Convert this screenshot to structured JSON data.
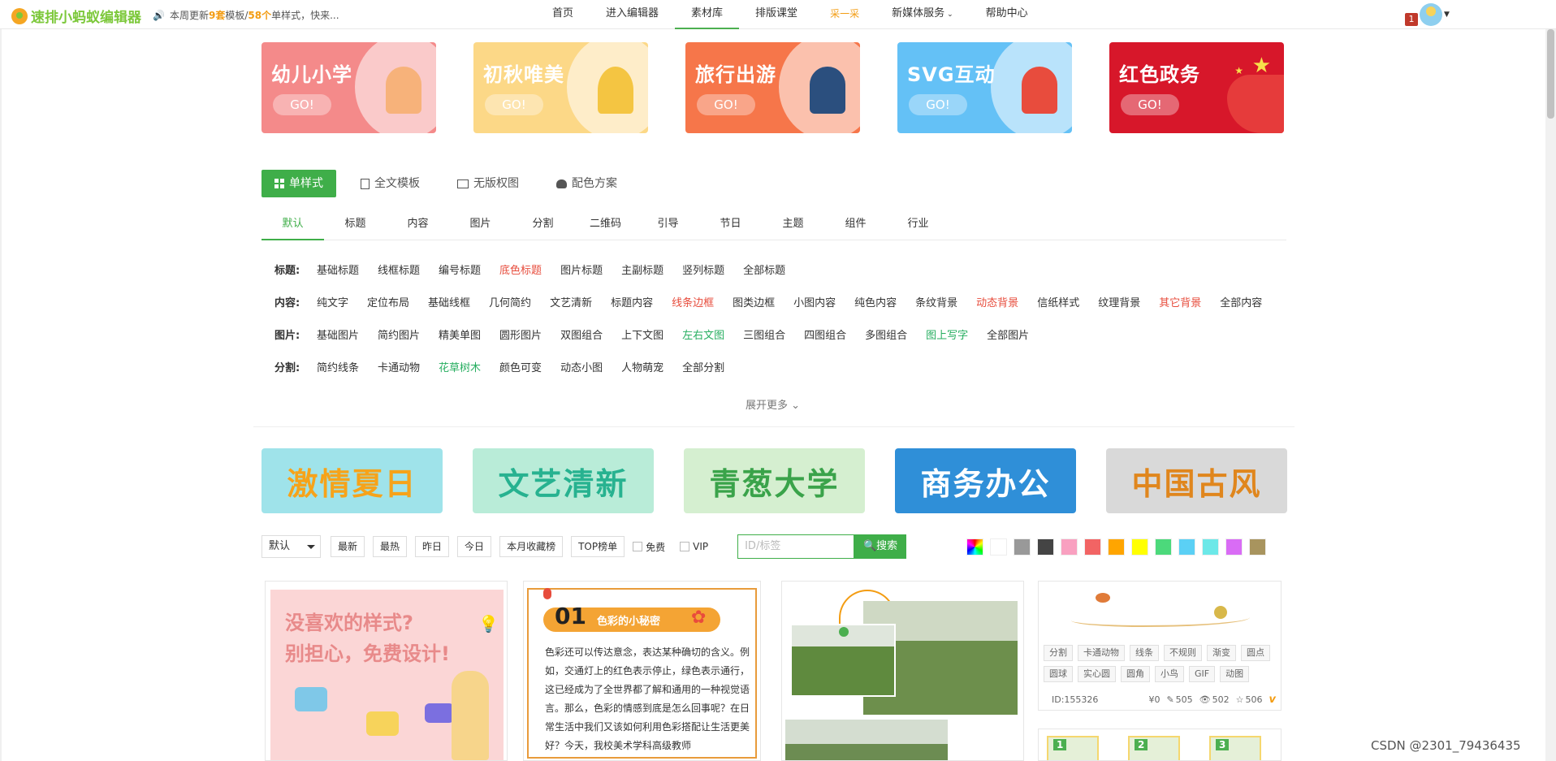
{
  "header": {
    "logo": "速排小蚂蚁编辑器",
    "notice": {
      "prefix": "本周更新",
      "count1": "9套",
      "mid": "模板/",
      "count2": "58个",
      "suffix": "单样式，快来..."
    },
    "nav": [
      {
        "label": "首页"
      },
      {
        "label": "进入编辑器"
      },
      {
        "label": "素材库"
      },
      {
        "label": "排版课堂"
      },
      {
        "label": "采一采"
      },
      {
        "label": "新媒体服务"
      },
      {
        "label": "帮助中心"
      }
    ],
    "badge": "1"
  },
  "banners": [
    {
      "title": "幼儿小学",
      "go": "GO!",
      "color": "#f48a8a"
    },
    {
      "title": "初秋唯美",
      "go": "GO!",
      "color": "#fcd887"
    },
    {
      "title": "旅行出游",
      "go": "GO!",
      "color": "#f6764a"
    },
    {
      "title": "SVG互动",
      "go": "GO!",
      "color": "#64c1f6"
    },
    {
      "title": "红色政务",
      "go": "GO!",
      "color": "#d7172a"
    }
  ],
  "type_tabs": [
    {
      "label": "单样式",
      "icon": "grid-icon"
    },
    {
      "label": "全文模板",
      "icon": "document-icon"
    },
    {
      "label": "无版权图",
      "icon": "image-icon"
    },
    {
      "label": "配色方案",
      "icon": "palette-icon"
    }
  ],
  "sub_tabs": [
    "默认",
    "标题",
    "内容",
    "图片",
    "分割",
    "二维码",
    "引导",
    "节日",
    "主题",
    "组件",
    "行业"
  ],
  "tag_rows": [
    {
      "label": "标题:",
      "tags": [
        {
          "t": "基础标题"
        },
        {
          "t": "线框标题"
        },
        {
          "t": "编号标题"
        },
        {
          "t": "底色标题",
          "c": "red"
        },
        {
          "t": "图片标题"
        },
        {
          "t": "主副标题"
        },
        {
          "t": "竖列标题"
        },
        {
          "t": "全部标题"
        }
      ]
    },
    {
      "label": "内容:",
      "tags": [
        {
          "t": "纯文字"
        },
        {
          "t": "定位布局"
        },
        {
          "t": "基础线框"
        },
        {
          "t": "几何简约"
        },
        {
          "t": "文艺清新"
        },
        {
          "t": "标题内容"
        },
        {
          "t": "线条边框",
          "c": "red"
        },
        {
          "t": "图类边框"
        },
        {
          "t": "小图内容"
        },
        {
          "t": "纯色内容"
        },
        {
          "t": "条纹背景"
        },
        {
          "t": "动态背景",
          "c": "red"
        },
        {
          "t": "信纸样式"
        },
        {
          "t": "纹理背景"
        },
        {
          "t": "其它背景",
          "c": "red"
        },
        {
          "t": "全部内容"
        }
      ]
    },
    {
      "label": "图片:",
      "tags": [
        {
          "t": "基础图片"
        },
        {
          "t": "简约图片"
        },
        {
          "t": "精美单图"
        },
        {
          "t": "圆形图片"
        },
        {
          "t": "双图组合"
        },
        {
          "t": "上下文图"
        },
        {
          "t": "左右文图",
          "c": "green"
        },
        {
          "t": "三图组合"
        },
        {
          "t": "四图组合"
        },
        {
          "t": "多图组合"
        },
        {
          "t": "图上写字",
          "c": "green"
        },
        {
          "t": "全部图片"
        }
      ]
    },
    {
      "label": "分割:",
      "tags": [
        {
          "t": "简约线条"
        },
        {
          "t": "卡通动物"
        },
        {
          "t": "花草树木",
          "c": "green"
        },
        {
          "t": "颜色可变"
        },
        {
          "t": "动态小图"
        },
        {
          "t": "人物萌宠"
        },
        {
          "t": "全部分割"
        }
      ]
    }
  ],
  "expand_label": "展开更多",
  "style_banners": [
    {
      "title": "激情夏日",
      "bg": "#9fe3ea",
      "fg": "#f6a31a"
    },
    {
      "title": "文艺清新",
      "bg": "#b9ecd8",
      "fg": "#27b290"
    },
    {
      "title": "青葱大学",
      "bg": "#d5efd0",
      "fg": "#3aa34a"
    },
    {
      "title": "商务办公",
      "bg": "#2f8fd8",
      "fg": "#ffffff"
    },
    {
      "title": "中国古风",
      "bg": "#d9d9d9",
      "fg": "#e0861d"
    }
  ],
  "filters": {
    "sort_select": "默认",
    "buttons": [
      "最新",
      "最热",
      "昨日",
      "今日",
      "本月收藏榜",
      "TOP榜单"
    ],
    "checkboxes": [
      "免费",
      "VIP"
    ],
    "search_placeholder": "ID/标签",
    "search_button": "搜索",
    "colors": [
      "rainbow",
      "#ffffff",
      "#999999",
      "#444444",
      "#f9a0c0",
      "#f26464",
      "#ffa500",
      "#ffff00",
      "#4cd97b",
      "#5bd0f5",
      "#6ce8e8",
      "#d96cf5",
      "#a8945e"
    ]
  },
  "cards": {
    "card1": {
      "line1": "没喜欢的样式?",
      "line2": "别担心，免费设计!"
    },
    "card2": {
      "num": "01",
      "title": "色彩的小秘密",
      "body": "色彩还可以传达意念，表达某种确切的含义。例如，交通灯上的红色表示停止，绿色表示通行，这已经成为了全世界都了解和通用的一种视觉语言。那么，色彩的情感到底是怎么回事呢？在日常生活中我们又该如何利用色彩搭配让生活更美好？今天，我校美术学科高级教师"
    },
    "card4": {
      "tags": [
        "分割",
        "卡通动物",
        "线条",
        "不规则",
        "渐变",
        "圆点",
        "圆球",
        "实心圆",
        "圆角",
        "小鸟",
        "GIF",
        "动图"
      ],
      "id": "ID:155326",
      "price": "¥0",
      "edits": "505",
      "views": "502",
      "stars": "506",
      "v": "v"
    },
    "card5": {
      "nums": [
        "1",
        "2",
        "3"
      ]
    }
  },
  "watermark": "CSDN @2301_79436435"
}
